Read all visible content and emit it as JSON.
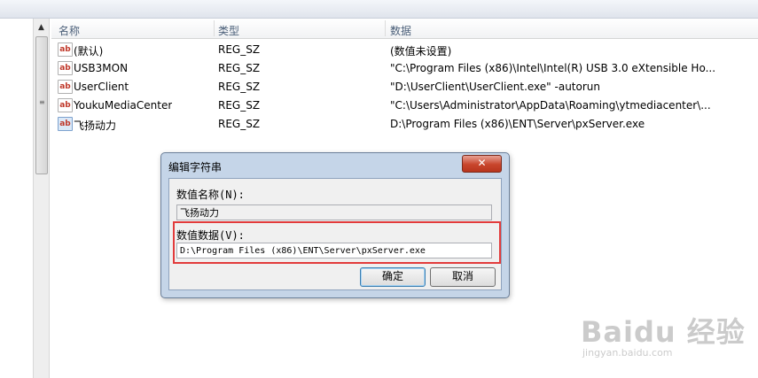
{
  "columns": {
    "name": "名称",
    "type": "类型",
    "data": "数据"
  },
  "rows": [
    {
      "icon": "ab",
      "name": "(默认)",
      "type": "REG_SZ",
      "data": "(数值未设置)"
    },
    {
      "icon": "ab",
      "name": "USB3MON",
      "type": "REG_SZ",
      "data": "\"C:\\Program Files (x86)\\Intel\\Intel(R) USB 3.0 eXtensible Ho..."
    },
    {
      "icon": "ab",
      "name": "UserClient",
      "type": "REG_SZ",
      "data": "\"D:\\UserClient\\UserClient.exe\" -autorun"
    },
    {
      "icon": "ab",
      "name": "YoukuMediaCenter",
      "type": "REG_SZ",
      "data": "\"C:\\Users\\Administrator\\AppData\\Roaming\\ytmediacenter\\..."
    },
    {
      "icon": "ab",
      "name": "飞扬动力",
      "type": "REG_SZ",
      "data": "D:\\Program Files (x86)\\ENT\\Server\\pxServer.exe"
    }
  ],
  "dialog": {
    "title": "编辑字符串",
    "close_label": "✕",
    "value_name_label": "数值名称(N):",
    "value_name": "飞扬动力",
    "value_data_label": "数值数据(V):",
    "value_data": "D:\\Program Files (x86)\\ENT\\Server\\pxServer.exe",
    "ok_label": "确定",
    "cancel_label": "取消"
  },
  "watermark": {
    "main": "Baidu 经验",
    "sub": "jingyan.baidu.com"
  },
  "colors": {
    "highlight": "#e23b3b",
    "close_button": "#c8452c"
  }
}
